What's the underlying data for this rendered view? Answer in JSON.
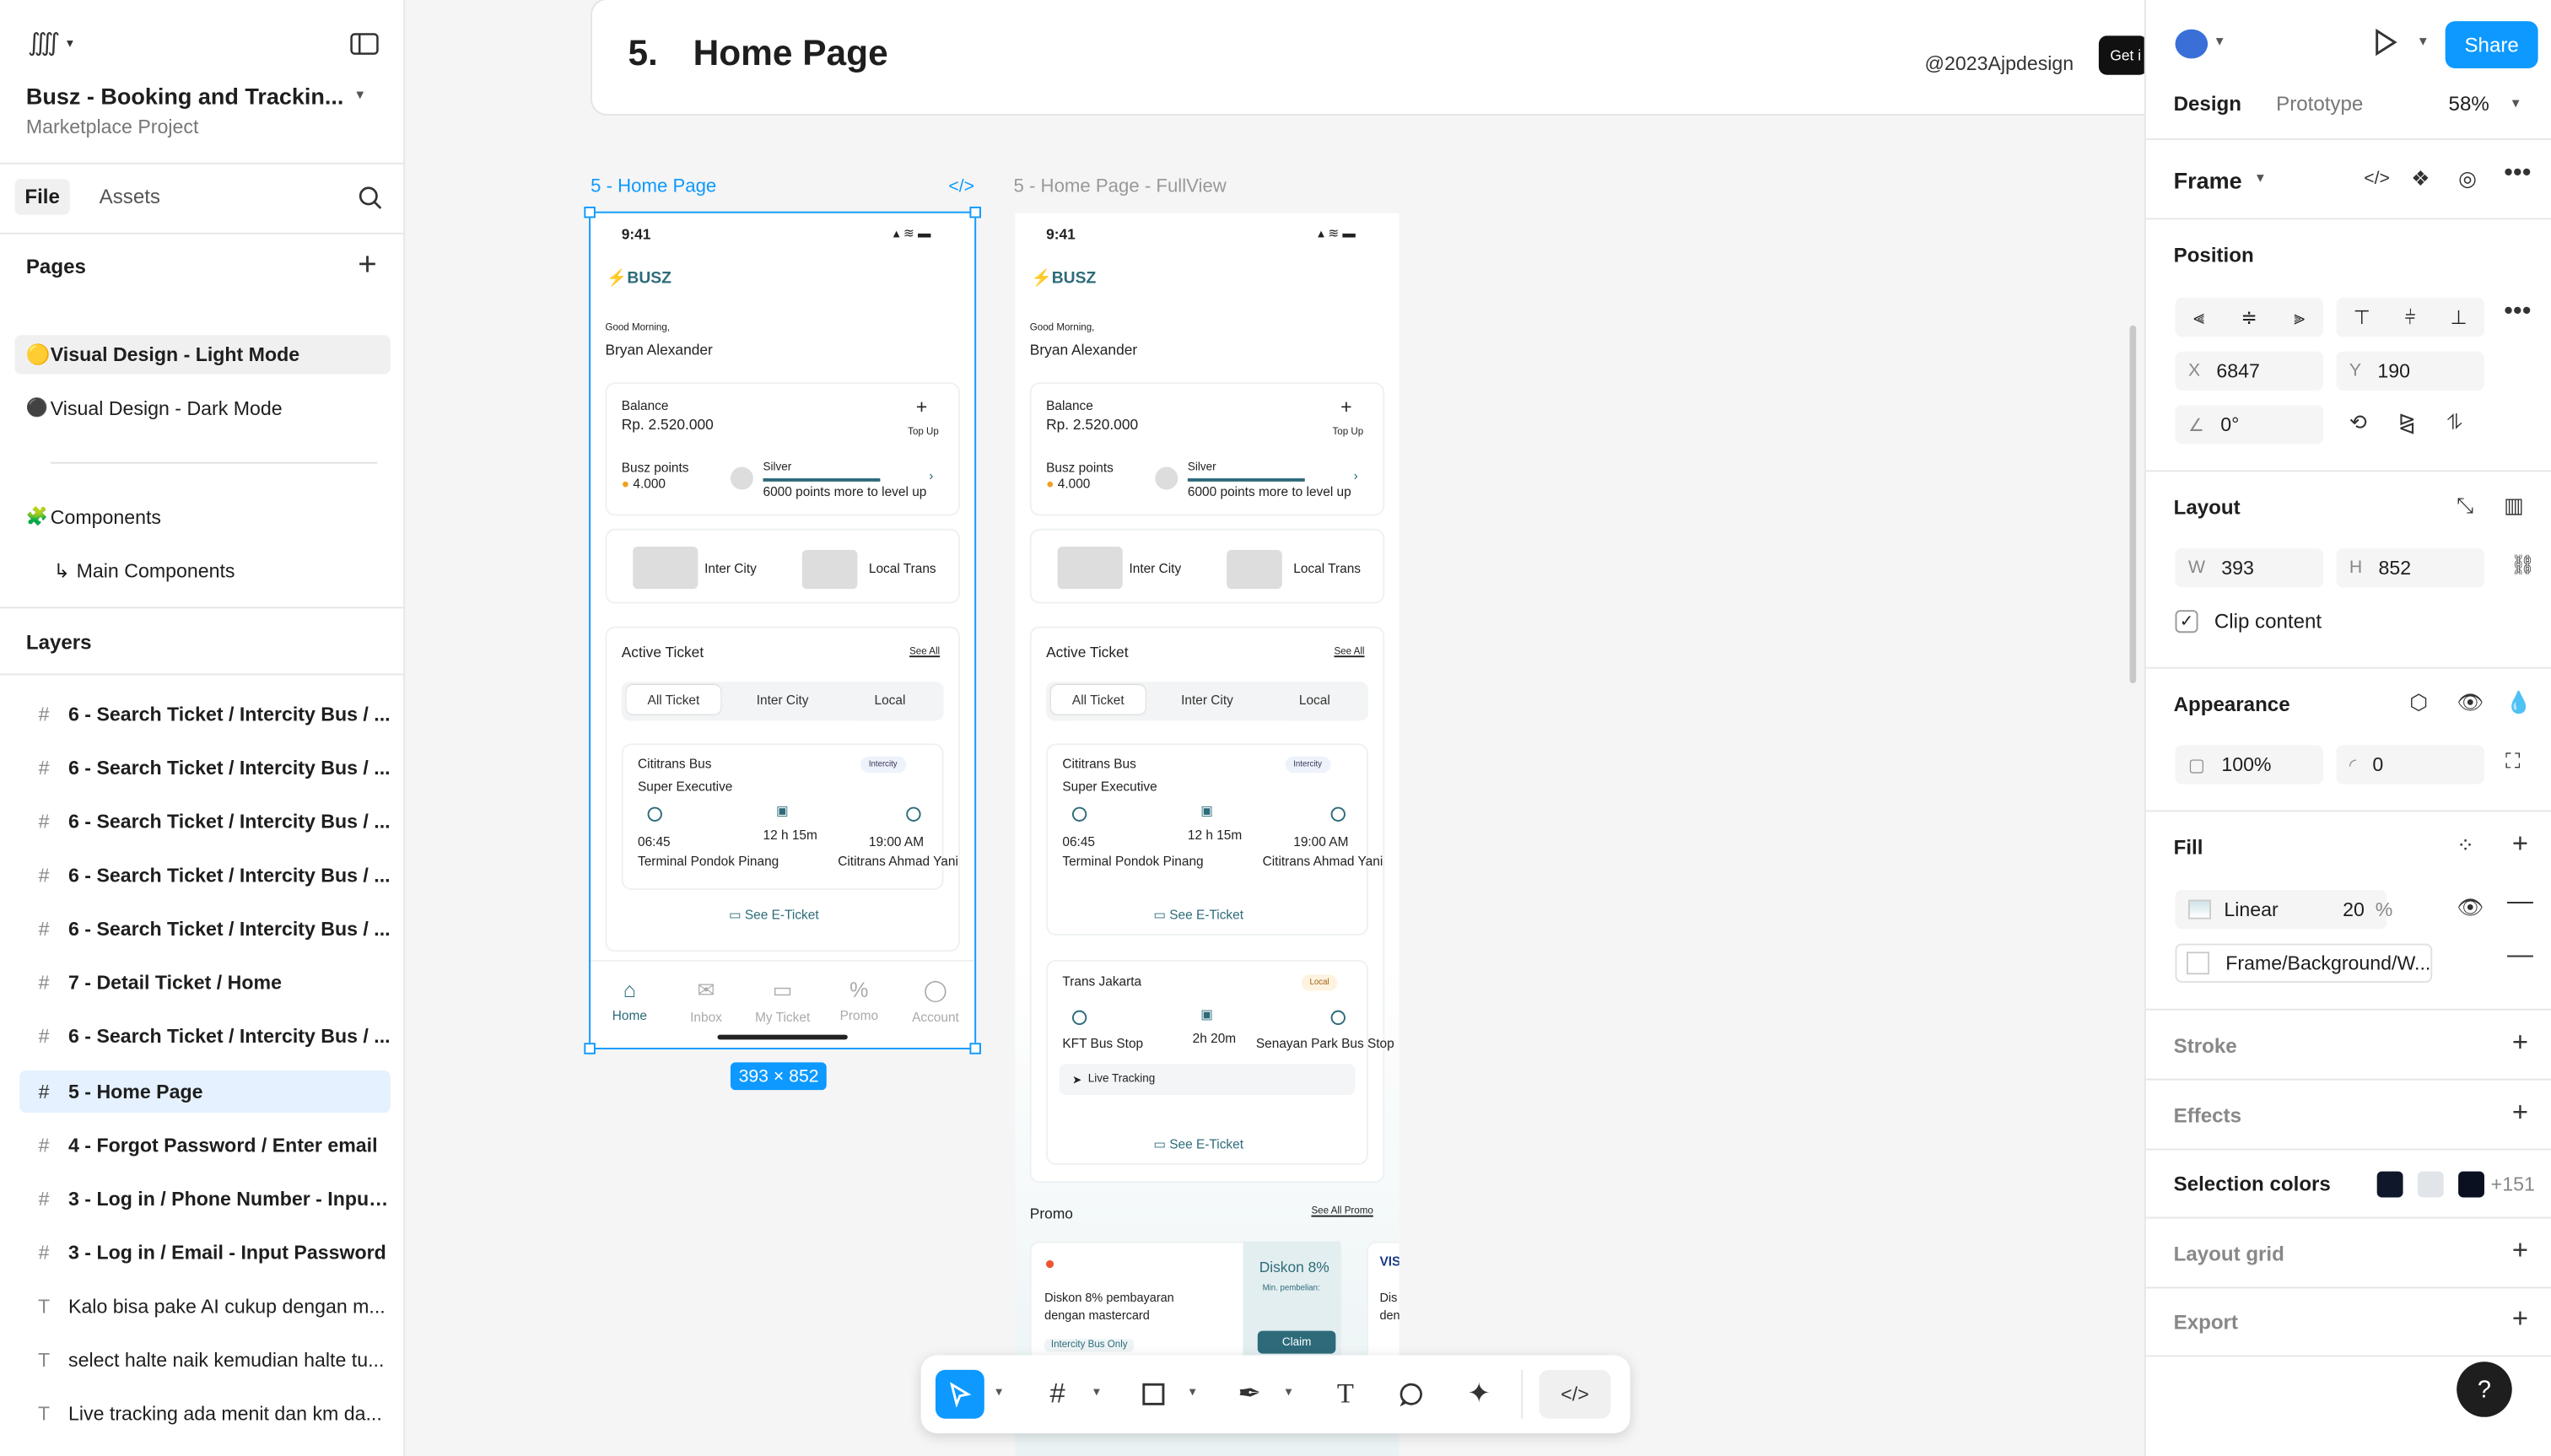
{
  "app": {
    "file_title": "Busz - Booking and Trackin...",
    "project": "Marketplace Project"
  },
  "left": {
    "tabs": [
      "File",
      "Assets"
    ],
    "pages_header": "Pages",
    "pages": [
      {
        "emoji": "🟡",
        "label": "Visual Design - Light Mode"
      },
      {
        "emoji": "⚫",
        "label": "Visual Design - Dark Mode"
      },
      {
        "emoji": "🧩",
        "label": "Components"
      },
      {
        "emoji": "↳",
        "label": "Main Components"
      }
    ],
    "layers_header": "Layers",
    "layers": [
      {
        "icon": "#",
        "label": "6 - Search Ticket / Intercity Bus / ..."
      },
      {
        "icon": "#",
        "label": "6 - Search Ticket / Intercity Bus / ..."
      },
      {
        "icon": "#",
        "label": "6 - Search Ticket / Intercity Bus / ..."
      },
      {
        "icon": "#",
        "label": "6 - Search Ticket / Intercity Bus / ..."
      },
      {
        "icon": "#",
        "label": "6 - Search Ticket / Intercity Bus / ..."
      },
      {
        "icon": "#",
        "label": "7 - Detail Ticket / Home"
      },
      {
        "icon": "#",
        "label": "6 - Search Ticket / Intercity Bus / ..."
      },
      {
        "icon": "#",
        "label": "5 - Home Page"
      },
      {
        "icon": "#",
        "label": "4 - Forgot Password / Enter email"
      },
      {
        "icon": "#",
        "label": "3 - Log in / Phone Number - Input..."
      },
      {
        "icon": "#",
        "label": "3 - Log in / Email - Input Password"
      },
      {
        "icon": "T",
        "label": "Kalo bisa pake AI cukup dengan m..."
      },
      {
        "icon": "T",
        "label": "select halte naik kemudian halte tu..."
      },
      {
        "icon": "T",
        "label": "Live tracking ada menit dan km da..."
      }
    ]
  },
  "canvas": {
    "section_number": "5.",
    "section_title": "Home Page",
    "handle": "@2023Ajpdesign",
    "get_btn": "Get i",
    "frame1_label": "5 - Home Page",
    "frame2_label": "5 - Home Page - FullView",
    "size_badge": "393 × 852"
  },
  "phone": {
    "time": "9:41",
    "brand": "BUSZ",
    "greeting": "Good Morning,",
    "name": "Bryan Alexander",
    "balance_label": "Balance",
    "balance": "Rp. 2.520.000",
    "topup": "Top Up",
    "points_label": "Busz points",
    "points": "4.000",
    "tier": "Silver",
    "tier_note": "6000 points more to level up",
    "cat1": "Inter City",
    "cat2": "Local Trans",
    "active_ticket": "Active Ticket",
    "see_all": "See All",
    "seg": [
      "All Ticket",
      "Inter City",
      "Local"
    ],
    "t1_name": "Cititrans Bus",
    "t1_class": "Super Executive",
    "t1_badge": "Intercity",
    "t1_dep": "06:45",
    "t1_dur": "12 h 15m",
    "t1_arr": "19:00 AM",
    "t1_from": "Terminal Pondok Pinang",
    "t1_to": "Cititrans Ahmad Yani",
    "eticket": "See E-Ticket",
    "t2_name": "Trans Jakarta",
    "t2_badge": "Local",
    "t2_dur": "2h 20m",
    "t2_from": "KFT Bus Stop",
    "t2_to": "Senayan Park Bus Stop",
    "live": "Live Tracking",
    "promo": "Promo",
    "see_all_promo": "See All Promo",
    "promo1": "Diskon 8% pembayaran dengan mastercard",
    "promo1_tag": "Intercity Bus Only",
    "promo_disc": "Diskon 8%",
    "promo_min": "Min. pembelian:",
    "claim": "Claim",
    "promo2": "Dis\nden",
    "nav": [
      "Home",
      "Inbox",
      "My Ticket",
      "Promo",
      "Account"
    ]
  },
  "right": {
    "tabs": [
      "Design",
      "Prototype"
    ],
    "zoom": "58%",
    "share": "Share",
    "frame_label": "Frame",
    "position": "Position",
    "x_label": "X",
    "x": "6847",
    "y_label": "Y",
    "y": "190",
    "rotation": "0°",
    "layout": "Layout",
    "w_label": "W",
    "w": "393",
    "h_label": "H",
    "h": "852",
    "clip": "Clip content",
    "appearance": "Appearance",
    "opacity": "100%",
    "radius": "0",
    "fill": "Fill",
    "fill_type": "Linear",
    "fill_pct": "20",
    "pct": "%",
    "fill_style": "Frame/Background/W...",
    "stroke": "Stroke",
    "effects": "Effects",
    "selection_colors": "Selection colors",
    "sel_more": "+151",
    "layout_grid": "Layout grid",
    "export": "Export",
    "help": "?"
  },
  "colors": {
    "accent": "#0d99ff",
    "selected_layer": "#e5f1ff",
    "teal": "#2d6b7a"
  }
}
